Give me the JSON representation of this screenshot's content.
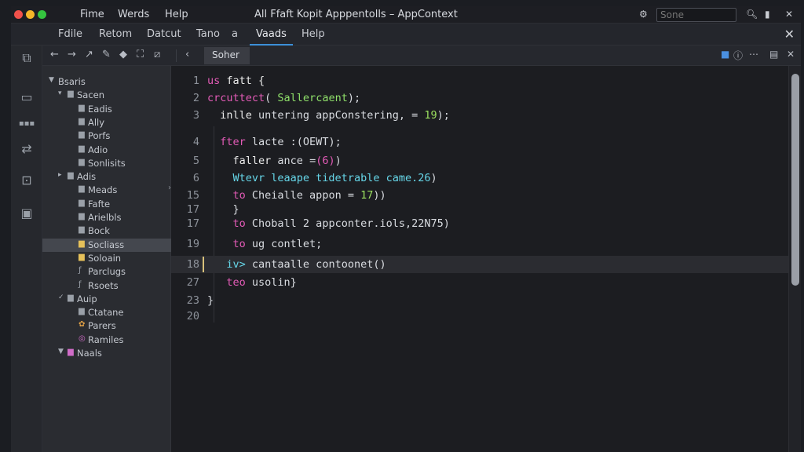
{
  "titlebar": {
    "menus": [
      "Fime",
      "Werds",
      "Help"
    ],
    "title": "All Ffaft    Kopit Apppentolls  –  AppContext",
    "search_placeholder": "Sone",
    "icons": [
      "settings-icon",
      "search-icon",
      "bookmark-icon",
      "close-icon"
    ]
  },
  "menubar": {
    "items": [
      "Fdile",
      "Retom",
      "Datcut",
      "Tano",
      "a",
      "Vaads",
      "Help"
    ],
    "active": "Vaads"
  },
  "toolbar": {
    "tab_label": "Soher"
  },
  "sidebar": {
    "items": [
      {
        "label": "Bsaris",
        "twisty": "▼",
        "icon": ""
      },
      {
        "label": "Sacen",
        "twisty": "▾",
        "icon": "▆"
      },
      {
        "label": "Eadis",
        "twisty": "",
        "icon": "▆"
      },
      {
        "label": "Ally",
        "twisty": "",
        "icon": "▆"
      },
      {
        "label": "Porfs",
        "twisty": "",
        "icon": "▆"
      },
      {
        "label": "Adio",
        "twisty": "",
        "icon": "▆"
      },
      {
        "label": "Sonlisits",
        "twisty": "",
        "icon": "▆"
      },
      {
        "label": "Adis",
        "twisty": "▸",
        "icon": "▆"
      },
      {
        "label": "Meads",
        "twisty": "",
        "icon": "▆"
      },
      {
        "label": "Fafte",
        "twisty": "",
        "icon": "▆"
      },
      {
        "label": "Arielbls",
        "twisty": "",
        "icon": "▆"
      },
      {
        "label": "Bock",
        "twisty": "",
        "icon": "▆"
      },
      {
        "label": "Socliass",
        "twisty": "",
        "icon": "▆"
      },
      {
        "label": "Soloain",
        "twisty": "",
        "icon": "▆"
      },
      {
        "label": "Parclugs",
        "twisty": "",
        "icon": "ƒ"
      },
      {
        "label": "Rsoets",
        "twisty": "",
        "icon": "ƒ"
      },
      {
        "label": "Auip",
        "twisty": "✓",
        "icon": "▆"
      },
      {
        "label": "Ctatane",
        "twisty": "",
        "icon": "▆"
      },
      {
        "label": "Parers",
        "twisty": "",
        "icon": "✿"
      },
      {
        "label": "Ramiles",
        "twisty": "",
        "icon": "◎"
      },
      {
        "label": "Naals",
        "twisty": "▼",
        "icon": "▆"
      }
    ],
    "selected_index": 12
  },
  "editor": {
    "lines": [
      {
        "n": "1",
        "tokens": [
          [
            "kw",
            "us"
          ],
          [
            "plain",
            " "
          ],
          [
            "fn",
            "fatt {"
          ]
        ]
      },
      {
        "n": "2",
        "tokens": [
          [
            "kw",
            "crcuttect"
          ],
          [
            "plain",
            "( "
          ],
          [
            "str",
            "Sallercaent"
          ],
          [
            "plain",
            ");"
          ]
        ]
      },
      {
        "n": "3",
        "tokens": [
          [
            "plain",
            "  "
          ],
          [
            "fn",
            "inlle"
          ],
          [
            "plain",
            " untering appConstering, = "
          ],
          [
            "num",
            "19"
          ],
          [
            "plain",
            ");"
          ]
        ]
      },
      {
        "n": "4",
        "tokens": [
          [
            "plain",
            "  "
          ],
          [
            "kw",
            "fter"
          ],
          [
            "plain",
            " lacte :(OEWT);"
          ]
        ]
      },
      {
        "n": "5",
        "tokens": [
          [
            "plain",
            "    "
          ],
          [
            "fn",
            "faller"
          ],
          [
            "plain",
            " ance ="
          ],
          [
            "kw",
            "(6)"
          ],
          [
            "plain",
            ")"
          ]
        ]
      },
      {
        "n": "6",
        "tokens": [
          [
            "plain",
            "    "
          ],
          [
            "cyan",
            "Wtevr leaape tidetrable came.26"
          ],
          [
            "plain",
            ")"
          ]
        ]
      },
      {
        "n": "15",
        "tokens": [
          [
            "plain",
            "    "
          ],
          [
            "kw",
            "to"
          ],
          [
            "plain",
            " Cheialle appon = "
          ],
          [
            "num",
            "17"
          ],
          [
            "plain",
            "))"
          ]
        ]
      },
      {
        "n": "17",
        "tokens": [
          [
            "plain",
            "    }"
          ]
        ]
      },
      {
        "n": "17",
        "tokens": [
          [
            "plain",
            "    "
          ],
          [
            "kw",
            "to"
          ],
          [
            "plain",
            " Choball 2 appconter.iols,22N75)"
          ]
        ]
      },
      {
        "n": "19",
        "tokens": [
          [
            "plain",
            "    "
          ],
          [
            "kw",
            "to"
          ],
          [
            "plain",
            " ug contlet;"
          ]
        ]
      },
      {
        "n": "18",
        "tokens": [
          [
            "plain",
            "   "
          ],
          [
            "cyan",
            "iv>"
          ],
          [
            "plain",
            " cantaalle contoonet()"
          ]
        ]
      },
      {
        "n": "27",
        "tokens": [
          [
            "plain",
            "   "
          ],
          [
            "kw",
            "teo"
          ],
          [
            "plain",
            " usolin}"
          ]
        ]
      },
      {
        "n": "23",
        "tokens": [
          [
            "plain",
            "}"
          ]
        ]
      },
      {
        "n": "20",
        "tokens": []
      }
    ],
    "current_line_index": 10
  }
}
